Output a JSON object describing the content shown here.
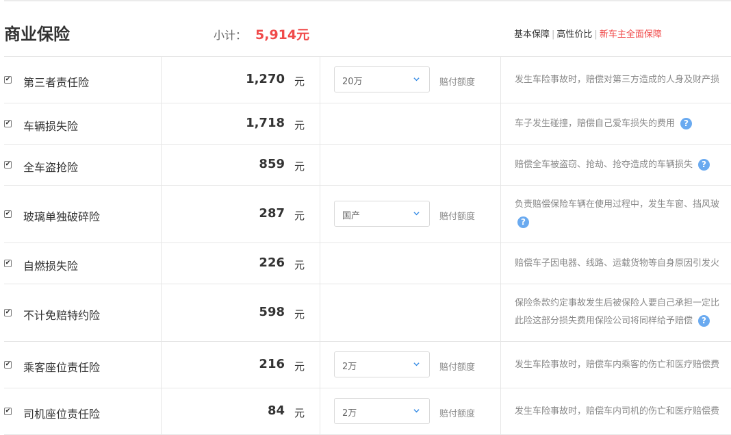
{
  "header": {
    "title": "商业保险",
    "subtotal_label": "小计：",
    "subtotal_value": "5,914元",
    "links": [
      "基本保障",
      "高性价比",
      "新车主全面保障"
    ]
  },
  "unit": "元",
  "items": [
    {
      "name": "第三者责任险",
      "price": "1,270",
      "select": "20万",
      "select_note": "赔付额度",
      "desc": "发生车险事故时，赔偿对第三方造成的人身及财产损"
    },
    {
      "name": "车辆损失险",
      "price": "1,718",
      "desc": "车子发生碰撞，赔偿自己爱车损失的费用"
    },
    {
      "name": "全车盗抢险",
      "price": "859",
      "desc": "赔偿全车被盗窃、抢劫、抢夺造成的车辆损失"
    },
    {
      "name": "玻璃单独破碎险",
      "price": "287",
      "select": "国产",
      "select_note": "赔付额度",
      "desc": "负责赔偿保险车辆在使用过程中，发生车窗、挡风玻"
    },
    {
      "name": "自燃损失险",
      "price": "226",
      "desc": "赔偿车子因电器、线路、运载货物等自身原因引发火"
    },
    {
      "name": "不计免赔特约险",
      "price": "598",
      "desc": "保险条款约定事故发生后被保险人要自己承担一定比",
      "desc2": "此险这部分损失费用保险公司将同样给予赔偿"
    },
    {
      "name": "乘客座位责任险",
      "price": "216",
      "select": "2万",
      "select_note": "赔付额度",
      "desc": "发生车险事故时，赔偿车内乘客的伤亡和医疗赔偿费"
    },
    {
      "name": "司机座位责任险",
      "price": "84",
      "select": "2万",
      "select_note": "赔付额度",
      "desc": "发生车险事故时，赔偿车内司机的伤亡和医疗赔偿费"
    }
  ]
}
